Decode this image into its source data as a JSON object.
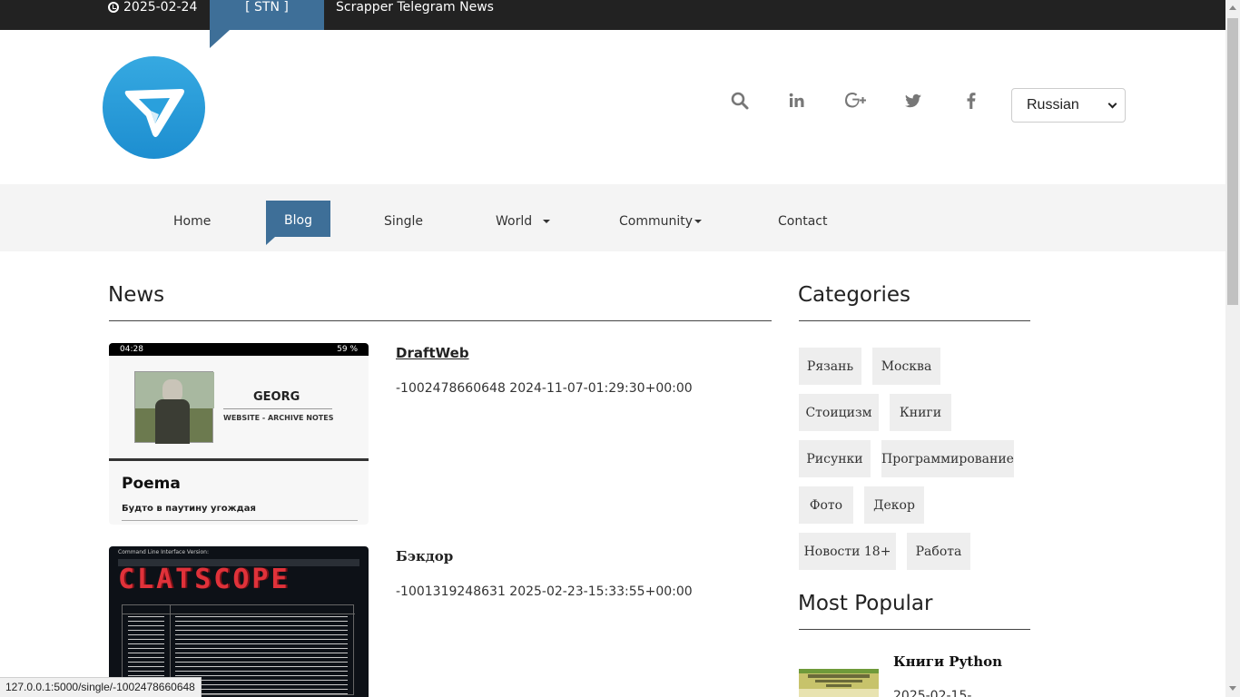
{
  "topbar": {
    "date": "2025-02-24",
    "tag": "[ STN ]",
    "ticker": "Scrapper Telegram News"
  },
  "header": {
    "language": "Russian",
    "social_icons": [
      "search-icon",
      "linkedin-icon",
      "google-plus-icon",
      "twitter-icon",
      "facebook-icon"
    ]
  },
  "nav": {
    "items": [
      {
        "label": "Home"
      },
      {
        "label": "Blog"
      },
      {
        "label": "Single"
      },
      {
        "label": "World"
      },
      {
        "label": "Community"
      },
      {
        "label": "Contact"
      }
    ]
  },
  "news": {
    "heading": "News",
    "posts": [
      {
        "title": "DraftWeb",
        "meta": "-1002478660648 2024-11-07-01:29:30+00:00",
        "thumb": {
          "time": "04:28",
          "battery": "59 %",
          "name": "GEORG",
          "subtitle": "WEBSITE - ARCHIVE NOTES",
          "poem_title": "Poema",
          "poem_line": "Будто в паутину угождая"
        }
      },
      {
        "title": "Бэкдор",
        "meta": "-1001319248631 2025-02-23-15:33:55+00:00",
        "thumb": {
          "header": "Command Line Interface Version:",
          "logo": "CLATSCOPE"
        }
      }
    ]
  },
  "categories": {
    "heading": "Categories",
    "items": [
      "Рязань",
      "Москва",
      "Стоицизм",
      "Книги",
      "Рисунки",
      "Программирование",
      "Фото",
      "Декор",
      "Новости 18+",
      "Работа"
    ]
  },
  "popular": {
    "heading": "Most Popular",
    "title": "Книги Python",
    "date": "2025-02-15-"
  },
  "status_url": "127.0.0.1:5000/single/-1002478660648",
  "colors": {
    "accent": "#3e6f98",
    "topbar": "#222222",
    "nav_bg": "#f4f4f4",
    "tag_bg": "#eeeeee"
  }
}
